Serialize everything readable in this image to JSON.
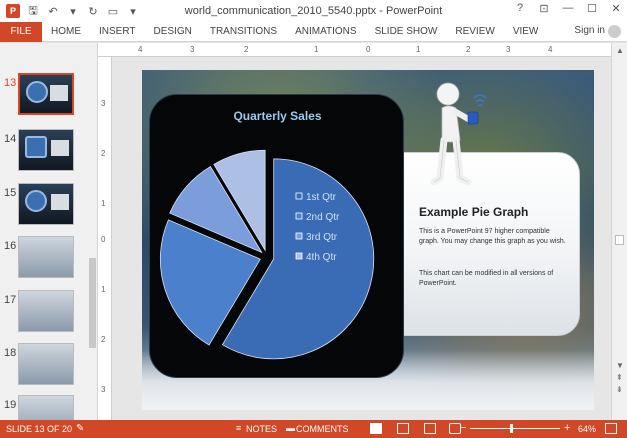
{
  "window": {
    "title": "world_communication_2010_5540.pptx - PowerPoint",
    "app_icon": "P",
    "controls": [
      "?",
      "⊡",
      "—",
      "☐",
      "✕"
    ]
  },
  "ribbon": {
    "file_label": "FILE",
    "tabs": [
      "HOME",
      "INSERT",
      "DESIGN",
      "TRANSITIONS",
      "ANIMATIONS",
      "SLIDE SHOW",
      "REVIEW",
      "VIEW"
    ],
    "sign_in": "Sign in"
  },
  "thumbnails": [
    {
      "num": "13",
      "active": true,
      "style": "dark"
    },
    {
      "num": "14",
      "active": false,
      "style": "dark"
    },
    {
      "num": "15",
      "active": false,
      "style": "dark"
    },
    {
      "num": "16",
      "active": false,
      "style": "light"
    },
    {
      "num": "17",
      "active": false,
      "style": "light"
    },
    {
      "num": "18",
      "active": false,
      "style": "light"
    },
    {
      "num": "19",
      "active": false,
      "style": "light"
    }
  ],
  "ruler": {
    "h_labels": [
      "4",
      "3",
      "2",
      "1",
      "0",
      "1",
      "2",
      "3",
      "4"
    ],
    "v_labels": [
      "3",
      "2",
      "1",
      "0",
      "1",
      "2",
      "3"
    ]
  },
  "slide": {
    "chart_title": "Quarterly Sales",
    "legend": [
      "1st Qtr",
      "2nd Qtr",
      "3rd Qtr",
      "4th Qtr"
    ],
    "info_title": "Example Pie Graph",
    "info_p1": "This is a PowerPoint 97 higher compatible graph.  You may change this graph as you wish.",
    "info_p2": "This chart can be modified in all versions of PowerPoint."
  },
  "chart_data": {
    "type": "pie",
    "title": "Quarterly Sales",
    "categories": [
      "1st Qtr",
      "2nd Qtr",
      "3rd Qtr",
      "4th Qtr"
    ],
    "values": [
      8.2,
      3.2,
      1.4,
      1.2
    ],
    "colors": [
      "#3a6bb5",
      "#4a80cc",
      "#7b9ddb",
      "#aebfe6"
    ],
    "legend_position": "right"
  },
  "status": {
    "slide_count": "SLIDE 13 OF 20",
    "notes": "NOTES",
    "comments": "COMMENTS",
    "zoom": "64%"
  }
}
